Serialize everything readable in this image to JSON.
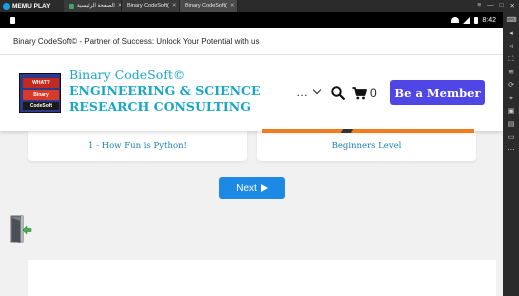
{
  "emulator": {
    "logo": "MEMU PLAY",
    "tabs": [
      {
        "label": "الصفحة الرئيسية",
        "active": false
      },
      {
        "label": "Binary CodeSoft(",
        "active": false
      },
      {
        "label": "Binary CodeSoft(",
        "active": true
      }
    ],
    "controls": [
      "≡",
      "—",
      "□",
      "✕"
    ]
  },
  "status_bar": {
    "time": "8:42"
  },
  "page": {
    "banner_text": "Binary CodeSoft© - Partner of Success: Unlock Your Potential with us",
    "brand": {
      "line1": "Binary CodeSoft©",
      "line2": "ENGINEERING & SCIENCE",
      "line3": "RESEARCH CONSULTING",
      "logo_text": [
        "WHAT?",
        "Binary",
        "CodeSoft"
      ]
    },
    "nav": {
      "menu_label": "…",
      "cart_count": "0",
      "member_button": "Be a Member"
    },
    "cards": [
      {
        "title": "1 - How Fun is Python!"
      },
      {
        "title": "Beginners Level"
      }
    ],
    "next_button": "Next"
  },
  "colors": {
    "brand_teal": "#1aa6c9",
    "member_purple": "#4f46e5",
    "next_blue": "#1e88e5",
    "card_link": "#1a7fb5",
    "orange": "#f07c1d"
  },
  "icons": {
    "search": "search-icon",
    "cart": "cart-icon",
    "menu": "chevron-down-icon",
    "next": "play-icon",
    "exit": "exit-door-icon"
  }
}
